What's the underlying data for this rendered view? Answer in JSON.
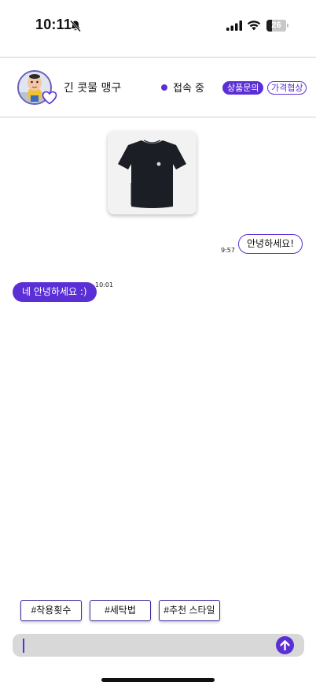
{
  "status_bar": {
    "time": "10:11",
    "battery_level": "26",
    "icons": [
      "bell-off-icon",
      "cellular-signal-icon",
      "wifi-icon",
      "battery-icon"
    ]
  },
  "header": {
    "user_name": "긴 콧물 맹구",
    "online_status": "접속 중",
    "tags": [
      "상품문의",
      "가격협상"
    ],
    "accent_color": "#5a2fd6"
  },
  "product": {
    "image_icon": "tshirt-icon",
    "color": "#1b1e24"
  },
  "messages": [
    {
      "text": "안녕하세요!",
      "time": "9:57",
      "side": "right"
    },
    {
      "text": "네 안녕하세요 :)",
      "time": "10:01",
      "side": "left"
    }
  ],
  "quick_tags": [
    "#착용횟수",
    "#세탁법",
    "#추천 스타일"
  ],
  "input": {
    "value": "",
    "placeholder": "",
    "send_icon": "arrow-up-icon"
  }
}
